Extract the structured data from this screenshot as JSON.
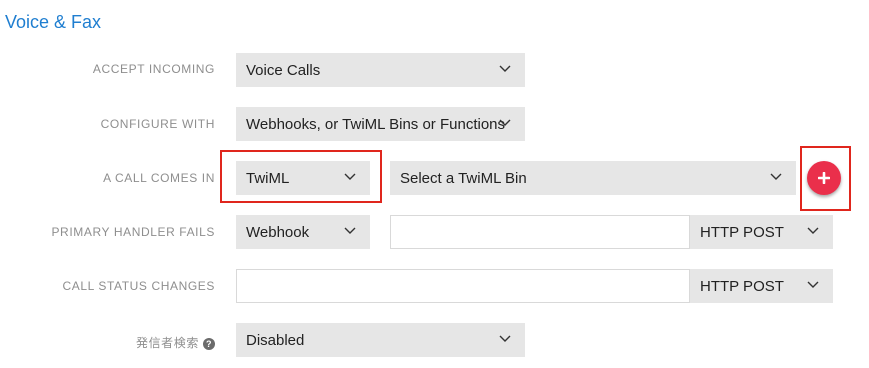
{
  "section_title": "Voice & Fax",
  "rows": {
    "accept_incoming": {
      "label": "ACCEPT INCOMING",
      "value": "Voice Calls"
    },
    "configure_with": {
      "label": "CONFIGURE WITH",
      "value": "Webhooks, or TwiML Bins or Functions"
    },
    "call_comes_in": {
      "label": "A CALL COMES IN",
      "type_value": "TwiML",
      "bin_value": "Select a TwiML Bin"
    },
    "primary_handler_fails": {
      "label": "PRIMARY HANDLER FAILS",
      "type_value": "Webhook",
      "url_value": "",
      "method_value": "HTTP POST"
    },
    "call_status_changes": {
      "label": "CALL STATUS CHANGES",
      "url_value": "",
      "method_value": "HTTP POST"
    },
    "caller_lookup": {
      "label": "発信者検索",
      "help_glyph": "?",
      "value": "Disabled"
    }
  },
  "colors": {
    "accent": "#1f7ed0",
    "highlight": "#e0261d",
    "add_button": "#ea2f4b"
  },
  "icons": {
    "dropdown": "chevron-down-icon",
    "add": "plus-icon",
    "help": "help-icon"
  }
}
